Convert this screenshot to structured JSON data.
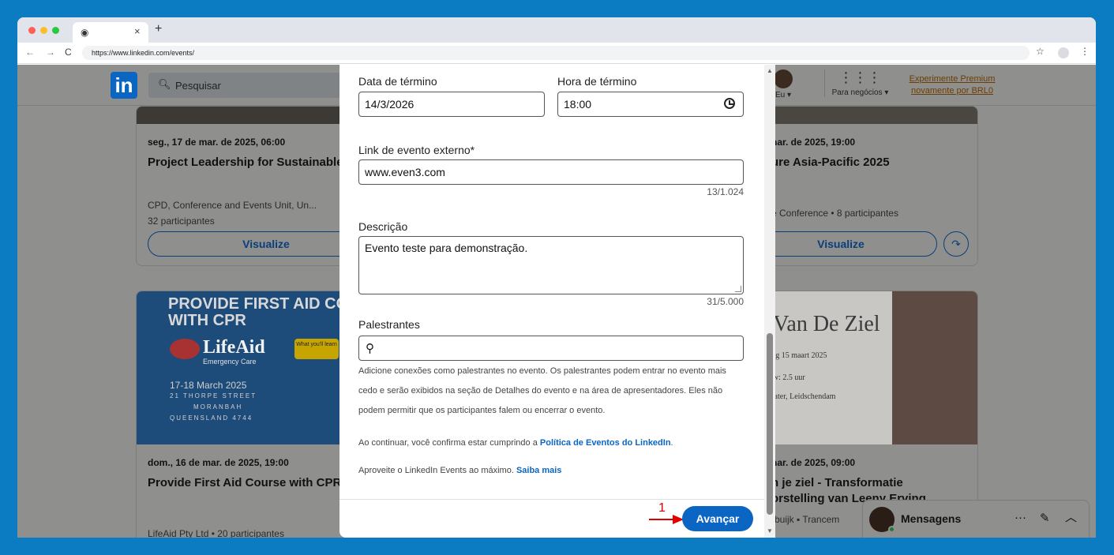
{
  "browser": {
    "tab_icon": "chrome-icon",
    "tab_close": "×",
    "new_tab": "+",
    "url": "https://www.linkedin.com/events/",
    "nav_back": "←",
    "nav_forward": "→",
    "nav_reload": "C",
    "star": "☆",
    "menu": "⋮",
    "traffic_colors": [
      "#ff5f57",
      "#febc2e",
      "#28c840"
    ]
  },
  "header": {
    "logo": "in",
    "search_placeholder": "Pesquisar",
    "me_label": "Eu ▾",
    "biz_label": "Para negócios ▾",
    "premium_line1": "Experimente Premium",
    "premium_line2": "novamente por BRL0"
  },
  "cards": {
    "c1": {
      "date": "seg., 17 de mar. de 2025, 06:00",
      "title": "Project Leadership for Sustainable",
      "org": "CPD, Conference and Events Unit, Un...",
      "participants": "32 participantes",
      "button": "Visualize"
    },
    "c2": {
      "date": "nar. de 2025, 19:00",
      "title": "ure Asia-Pacific 2025",
      "org": "e Conference  • 8 participantes",
      "button": "Visualize"
    },
    "c3": {
      "promo_title_1": "PROVIDE FIRST AID CO",
      "promo_title_2": "WITH CPR",
      "promo_brand": "LifeAid",
      "promo_sub": "Emergency Care",
      "promo_tag": "What you'll learn",
      "promo_dates_1": "17-18 March 2025",
      "promo_dates_2": "21 THORPE STREET",
      "promo_dates_3": "MORANBAH",
      "promo_dates_4": "QUEENSLAND 4744",
      "date": "dom., 16 de mar. de 2025, 19:00",
      "title": "Provide First Aid Course with CPR",
      "org": "LifeAid Pty Ltd  • 20 participantes"
    },
    "c4": {
      "img_title": "l Van De Ziel",
      "img_line1": "erdag 15 maart 2025",
      "img_line2": "00",
      "img_line3": "show: 2.5 uur",
      "img_line4": "Theater, Leidschendam",
      "date": "nar. de 2025, 09:00",
      "title_1": "n je ziel - Transformatie",
      "title_2": "orstelling van Leeny Erving",
      "org": "rbuijk  ▪  Trancem"
    }
  },
  "modal": {
    "end_date_label": "Data de término",
    "end_date_value": "14/3/2026",
    "end_time_label": "Hora de término",
    "end_time_value": "18:00",
    "link_label": "Link de evento externo*",
    "link_value": "www.even3.com",
    "link_counter": "13/1.024",
    "desc_label": "Descrição",
    "desc_value": "Evento teste para demonstração.",
    "desc_counter": "31/5.000",
    "speakers_label": "Palestrantes",
    "speakers_help": "Adicione conexões como palestrantes no evento. Os palestrantes podem entrar no evento mais cedo e serão exibidos na seção de Detalhes do evento e na área de apresentadores. Eles não podem permitir que os participantes falem ou encerrar o evento.",
    "policy_prefix": "Ao continuar, você confirma estar cumprindo a ",
    "policy_link": "Política de Eventos do LinkedIn",
    "policy_suffix": ".",
    "learn_prefix": "Aproveite o LinkedIn Events ao máximo. ",
    "learn_link": "Saiba mais",
    "next_button": "Avançar",
    "annotation_number": "1"
  },
  "messages": {
    "title": "Mensagens",
    "more": "···",
    "compose": "✎",
    "collapse": "︿"
  }
}
